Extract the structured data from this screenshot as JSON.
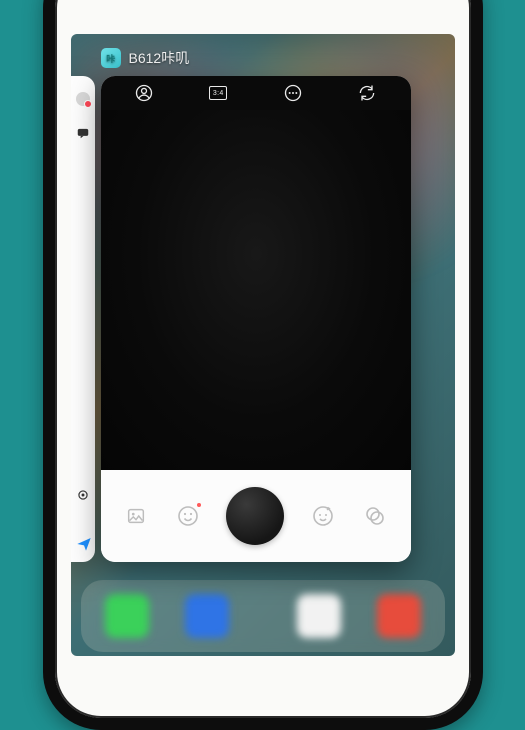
{
  "switcher": {
    "app_icon_glyph": "咔",
    "app_name": "B612咔叽"
  },
  "camera": {
    "top": {
      "home_icon": "home-icon",
      "ratio_label": "3:4",
      "more_icon": "more-icon",
      "flip_icon": "camera-flip-icon"
    },
    "bottom": {
      "gallery_icon": "gallery-icon",
      "sticker_icon": "sticker-icon",
      "shutter": "shutter-button",
      "beauty_icon": "beauty-icon",
      "filter_icon": "filter-icon"
    }
  },
  "peek_app": {
    "avatar": "avatar-icon",
    "chat": "chat-icon",
    "location": "location-icon",
    "send": "send-icon"
  }
}
